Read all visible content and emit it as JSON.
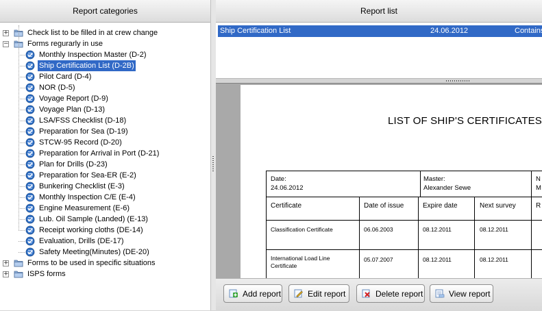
{
  "left_panel": {
    "title": "Report categories"
  },
  "tree": [
    {
      "label": "Check list to be filled in at crew change",
      "level": 0,
      "expander": "+",
      "type": "folder"
    },
    {
      "label": "Forms regurarly in use",
      "level": 0,
      "expander": "−",
      "type": "folder"
    },
    {
      "label": "Monthly Inspection Master (D-2)",
      "level": 1,
      "type": "doc"
    },
    {
      "label": "Ship Certification List (D-2B)",
      "level": 1,
      "type": "doc",
      "selected": true
    },
    {
      "label": "Pilot Card (D-4)",
      "level": 1,
      "type": "doc"
    },
    {
      "label": "NOR (D-5)",
      "level": 1,
      "type": "doc"
    },
    {
      "label": "Voyage Report (D-9)",
      "level": 1,
      "type": "doc"
    },
    {
      "label": "Voyage Plan (D-13)",
      "level": 1,
      "type": "doc"
    },
    {
      "label": "LSA/FSS Checklist (D-18)",
      "level": 1,
      "type": "doc"
    },
    {
      "label": "Preparation for Sea (D-19)",
      "level": 1,
      "type": "doc"
    },
    {
      "label": "STCW-95 Record (D-20)",
      "level": 1,
      "type": "doc"
    },
    {
      "label": "Preparation for Arrival in Port (D-21)",
      "level": 1,
      "type": "doc"
    },
    {
      "label": "Plan for Drills (D-23)",
      "level": 1,
      "type": "doc"
    },
    {
      "label": "Preparation for Sea-ER (E-2)",
      "level": 1,
      "type": "doc"
    },
    {
      "label": "Bunkering Checklist (E-3)",
      "level": 1,
      "type": "doc"
    },
    {
      "label": "Monthly Inspection C/E (E-4)",
      "level": 1,
      "type": "doc"
    },
    {
      "label": "Engine Measurement (E-6)",
      "level": 1,
      "type": "doc"
    },
    {
      "label": "Lub. Oil Sample (Landed) (E-13)",
      "level": 1,
      "type": "doc"
    },
    {
      "label": "Receipt working cloths (DE-14)",
      "level": 1,
      "type": "doc"
    },
    {
      "label": "Evaluation, Drills (DE-17)",
      "level": 1,
      "type": "doc"
    },
    {
      "label": "Safety Meeting(Minutes) (DE-20)",
      "level": 1,
      "type": "doc"
    },
    {
      "label": "Forms to be used in specific situations",
      "level": 0,
      "expander": "+",
      "type": "folder"
    },
    {
      "label": "ISPS forms",
      "level": 0,
      "expander": "+",
      "type": "folder"
    }
  ],
  "report_list": {
    "title": "Report list",
    "rows": [
      {
        "name": "Ship Certification List",
        "date": "24.06.2012",
        "status": "Contains"
      }
    ]
  },
  "preview": {
    "title": "LIST OF SHIP'S CERTIFICATES",
    "info": {
      "date_label": "Date:",
      "date_value": "24.06.2012",
      "master_label": "Master:",
      "master_value": "Alexander Sewe",
      "third_label": "N",
      "third_value": "M"
    },
    "columns": [
      "Certificate",
      "Date of issue",
      "Expire date",
      "Next survey",
      "R"
    ],
    "rows": [
      [
        "Classification Certificate",
        "06.06.2003",
        "08.12.2011",
        "08.12.2011"
      ],
      [
        "International Load Line Certificate",
        "05.07.2007",
        "08.12.2011",
        "08.12.2011"
      ]
    ]
  },
  "buttons": {
    "add": "Add report",
    "edit": "Edit report",
    "delete": "Delete report",
    "view": "View report"
  },
  "colors": {
    "selection": "#3169c6",
    "panel_header": "#e6e6e6"
  }
}
